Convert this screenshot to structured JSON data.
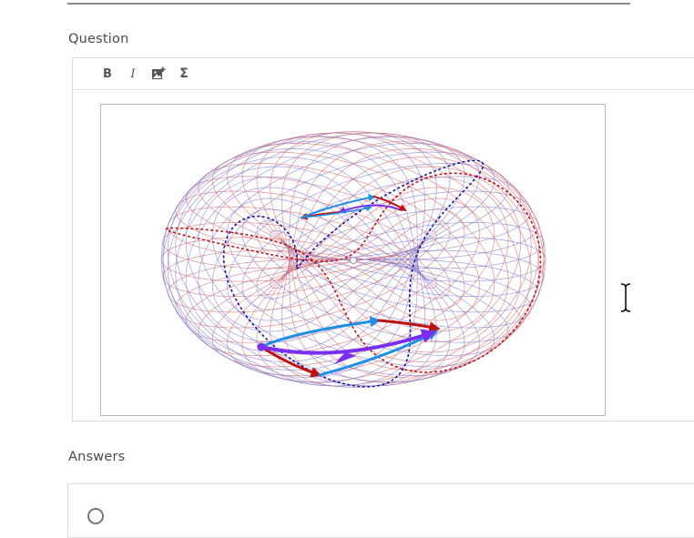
{
  "question_section": {
    "label": "Question",
    "toolbar": {
      "bold_label": "B",
      "italic_label": "I",
      "insert_image_icon": "image-plus-icon",
      "formula_label": "Σ"
    },
    "figure": {
      "surface": "torus",
      "mesh_colors": [
        "#d96b6b",
        "#7d7dd9"
      ],
      "path_colors": {
        "red_dashed": "#c41212",
        "blue_dashed": "#1717a8",
        "red_arrow": "#c01010",
        "cyan_arrow": "#1e90e8",
        "purple_arrow": "#7a2ef0"
      }
    }
  },
  "answers_section": {
    "label": "Answers"
  },
  "cursor": "text-cursor-icon"
}
